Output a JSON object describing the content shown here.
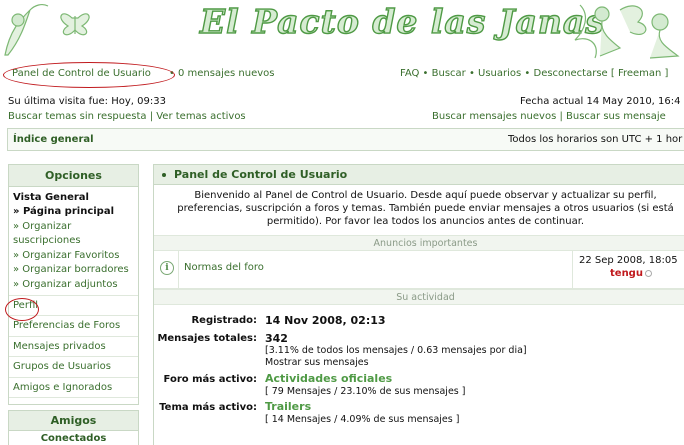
{
  "banner": {
    "title": "El Pacto de las Janas",
    "left_deco_icon": "butterfly-icon",
    "right_deco_icon": "fairy-icon"
  },
  "topnav": {
    "ucp_label": "Panel de Control de Usuario",
    "separator": "•",
    "new_messages": "0 mensajes nuevos",
    "right_links": "FAQ • Buscar • Usuarios • Desconectarse [ Freeman ]"
  },
  "info": {
    "last_visit": "Su última visita fue: Hoy, 09:33",
    "current_time": "Fecha actual 14 May 2010, 16:4",
    "search_left": "Buscar temas sin respuesta | Ver temas activos",
    "search_right": "Buscar mensajes nuevos | Buscar sus mensaje"
  },
  "indexbar": {
    "index_label": "Índice general",
    "timezone": "Todos los horarios son UTC + 1 hor"
  },
  "sidebar": {
    "header": "Opciones",
    "group_title": "Vista General",
    "group_items": [
      {
        "label": "» Página principal",
        "active": true
      },
      {
        "label": "» Organizar suscripciones",
        "active": false
      },
      {
        "label": "» Organizar Favoritos",
        "active": false
      },
      {
        "label": "» Organizar borradores",
        "active": false
      },
      {
        "label": "» Organizar adjuntos",
        "active": false
      }
    ],
    "links": [
      "Perfil",
      "Preferencias de Foros",
      "Mensajes privados",
      "Grupos de Usuarios",
      "Amigos e Ignorados"
    ]
  },
  "friends": {
    "header": "Amigos",
    "subheader": "Conectados"
  },
  "main": {
    "header": "Panel de Control de Usuario",
    "welcome": "Bienvenido al Panel de Control de Usuario. Desde aquí puede observar y actualizar su perfil, preferencias, suscripción a foros y temas. También puede enviar mensajes a otros usuarios (si está permitido). Por favor lea todos los anuncios antes de continuar.",
    "announcements_header": "Anuncios importantes",
    "announcement": {
      "title": "Normas del foro",
      "date": "22 Sep 2008, 18:05",
      "author": "tengu",
      "icon": "info-icon"
    },
    "activity_header": "Su actividad",
    "stats": {
      "registered_label": "Registrado:",
      "registered_value": "14 Nov 2008, 02:13",
      "posts_label": "Mensajes totales:",
      "posts_value": "342",
      "posts_detail": "[3.11% de todos los mensajes / 0.63 mensajes por dia]",
      "posts_link": "Mostrar sus mensajes",
      "forum_label": "Foro más activo:",
      "forum_value": "Actividades oficiales",
      "forum_detail": "[ 79 Mensajes / 23.10% de sus mensajes ]",
      "topic_label": "Tema más activo:",
      "topic_value": "Trailers",
      "topic_detail": "[ 14 Mensajes / 4.09% de sus mensajes ]"
    }
  },
  "colors": {
    "accent": "#2f5f26",
    "link": "#3a6f2e",
    "highlight_circle": "#c0191d",
    "header_bg": "#e7efe4"
  }
}
